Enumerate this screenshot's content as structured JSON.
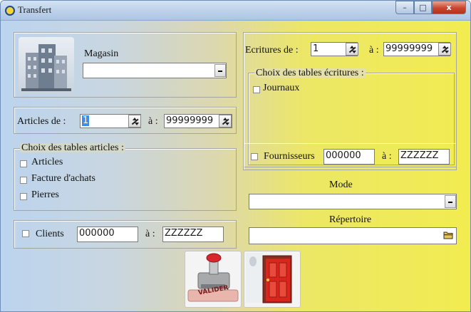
{
  "window": {
    "title": "Transfert",
    "controls": {
      "minimize": "–",
      "maximize": "□",
      "close": "x"
    }
  },
  "magasin": {
    "label": "Magasin",
    "value": ""
  },
  "articles": {
    "from_label": "Articles de :",
    "from_value": "1",
    "to_label": "à :",
    "to_value": "99999999"
  },
  "tables_articles": {
    "title": "Choix des tables articles :",
    "items": [
      {
        "label": "Articles",
        "checked": false
      },
      {
        "label": "Facture d'achats",
        "checked": false
      },
      {
        "label": "Pierres",
        "checked": false
      }
    ]
  },
  "clients": {
    "label": "Clients",
    "from_value": "000000",
    "to_label": "à :",
    "to_value": "ZZZZZZ",
    "checked": false
  },
  "ecritures": {
    "from_label": "Ecritures de :",
    "from_value": "1",
    "to_label": "à :",
    "to_value": "99999999"
  },
  "tables_ecritures": {
    "title": "Choix des tables écritures :",
    "items": [
      {
        "label": "Journaux",
        "checked": false
      }
    ]
  },
  "fournisseurs": {
    "label": "Fournisseurs",
    "from_value": "000000",
    "to_label": "à :",
    "to_value": "ZZZZZZ",
    "checked": false
  },
  "mode": {
    "label": "Mode",
    "value": ""
  },
  "repertoire": {
    "label": "Répertoire",
    "value": ""
  },
  "buttons": {
    "validate_stamp_text": "VALIDER"
  },
  "colors": {
    "bg_left": "#c9d6df",
    "bg_right": "#f2ec50",
    "title_bar": "#bed2ea",
    "close_red": "#c8452e",
    "door_red": "#d9251c"
  }
}
